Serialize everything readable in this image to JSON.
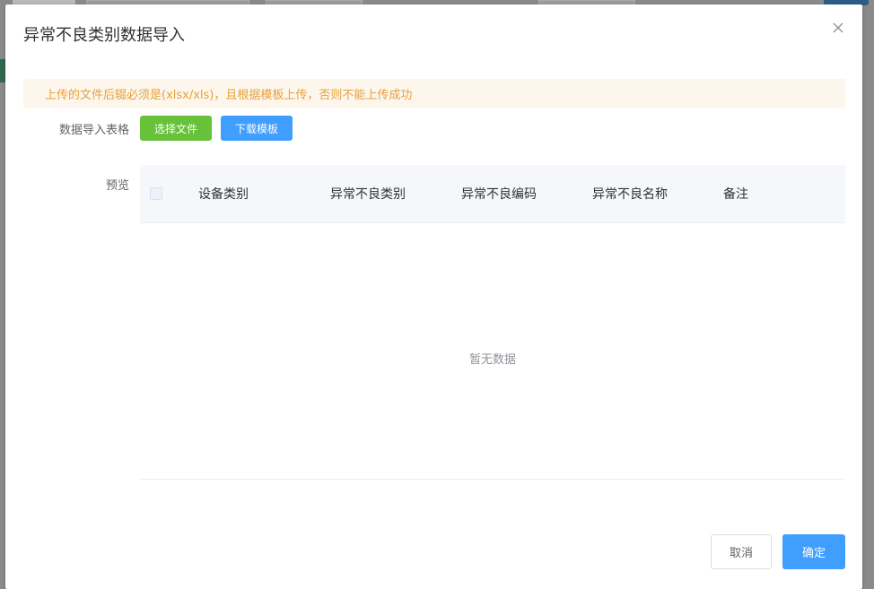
{
  "dialog": {
    "title": "异常不良类别数据导入",
    "close_icon": "close-icon"
  },
  "alert": {
    "text": "上传的文件后辍必须是(xlsx/xls)，且根据模板上传，否则不能上传成功",
    "color": "#e6a23c",
    "background": "#fdf6ec"
  },
  "form": {
    "import_label": "数据导入表格",
    "select_file_label": "选择文件",
    "download_template_label": "下载模板",
    "preview_label": "预览"
  },
  "table": {
    "columns": [
      "设备类别",
      "异常不良类别",
      "异常不良编码",
      "异常不良名称",
      "备注"
    ],
    "rows": [],
    "empty_text": "暂无数据"
  },
  "footer": {
    "cancel_label": "取消",
    "confirm_label": "确定"
  },
  "colors": {
    "primary": "#409eff",
    "success": "#67c23a"
  }
}
